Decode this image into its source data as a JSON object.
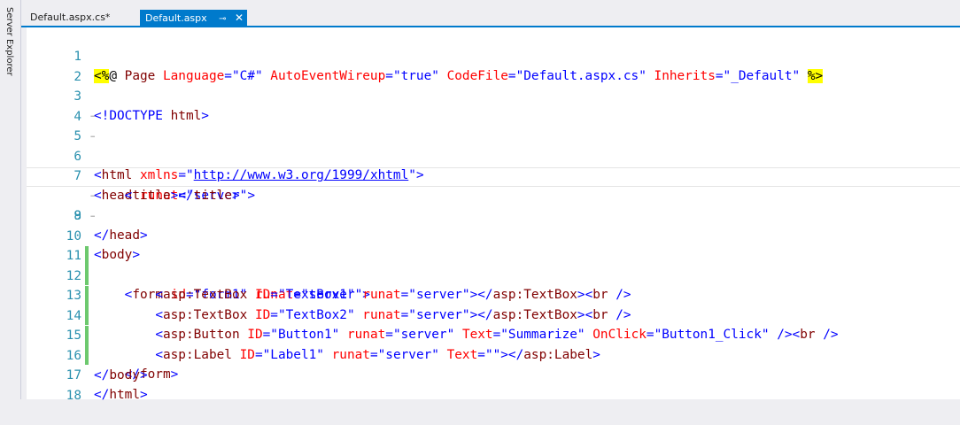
{
  "sidebar": {
    "server_explorer_label": "Server Explorer"
  },
  "tabs": [
    {
      "label": "Default.aspx.cs*",
      "active": false
    },
    {
      "label": "Default.aspx",
      "active": true,
      "pin_icon": "⊸",
      "close_icon": "✕"
    }
  ],
  "colors": {
    "accent": "#007acc",
    "line_number": "#2b91af",
    "change_marker": "#6dc96e",
    "directive_highlight": "#ffff00"
  },
  "editor": {
    "line_numbers": [
      "1",
      "2",
      "3",
      "4",
      "5",
      "6",
      "7",
      "8",
      "9",
      "10",
      "11",
      "12",
      "13",
      "14",
      "15",
      "16",
      "17",
      "18"
    ],
    "l1": {
      "open": "<%",
      "at": "@",
      "page": " Page ",
      "a1": "Language",
      "eq": "=",
      "v1": "\"C#\"",
      "a2": "AutoEventWireup",
      "v2": "\"true\"",
      "a3": "CodeFile",
      "v3": "\"Default.aspx.cs\"",
      "a4": "Inherits",
      "v4": "\"_Default\"",
      "close": "%>"
    },
    "l3": {
      "open": "<!DOCTYPE ",
      "name": "html",
      "close": ">"
    },
    "l5": {
      "lt": "<",
      "tag": "html",
      "attr": "xmlns",
      "eq": "=",
      "q1": "\"",
      "url": "http://www.w3.org/1999/xhtml",
      "q2": "\"",
      "gt": ">"
    },
    "l6": {
      "lt": "<",
      "tag": "head",
      "attr": "runat",
      "eq": "=",
      "val": "\"server\"",
      "gt": ">"
    },
    "l7": {
      "open": "<",
      "tag1": "title",
      "mid": "></",
      "tag2": "title",
      "gt": ">"
    },
    "l8": {
      "lt": "</",
      "tag": "head",
      "gt": ">"
    },
    "l9": {
      "lt": "<",
      "tag": "body",
      "gt": ">"
    },
    "l10": {
      "lt": "<",
      "tag": "form",
      "a1": "id",
      "v1": "\"form1\"",
      "a2": "runat",
      "v2": "\"server\"",
      "gt": ">"
    },
    "l11": {
      "tag": "asp:TextBox",
      "a1": "ID",
      "v1": "\"TextBox1\"",
      "a2": "runat",
      "v2": "\"server\"",
      "close": "asp:TextBox",
      "br": "br",
      "sl": " />"
    },
    "l12": {
      "tag": "asp:TextBox",
      "a1": "ID",
      "v1": "\"TextBox2\"",
      "a2": "runat",
      "v2": "\"server\"",
      "close": "asp:TextBox",
      "br": "br",
      "sl": " />"
    },
    "l13": {
      "tag": "asp:Button",
      "a1": "ID",
      "v1": "\"Button1\"",
      "a2": "runat",
      "v2": "\"server\"",
      "a3": "Text",
      "v3": "\"Summarize\"",
      "a4": "OnClick",
      "v4": "\"Button1_Click\"",
      "sl": " />",
      "br": "br"
    },
    "l14": {
      "tag": "asp:Label",
      "a1": "ID",
      "v1": "\"Label1\"",
      "a2": "runat",
      "v2": "\"server\"",
      "a3": "Text",
      "v3": "\"\"",
      "close": "asp:Label"
    },
    "l15": {
      "lt": "</",
      "tag": "form",
      "gt": ">"
    },
    "l16": {
      "lt": "</",
      "tag": "body",
      "gt": ">"
    },
    "l17": {
      "lt": "</",
      "tag": "html",
      "gt": ">"
    }
  }
}
